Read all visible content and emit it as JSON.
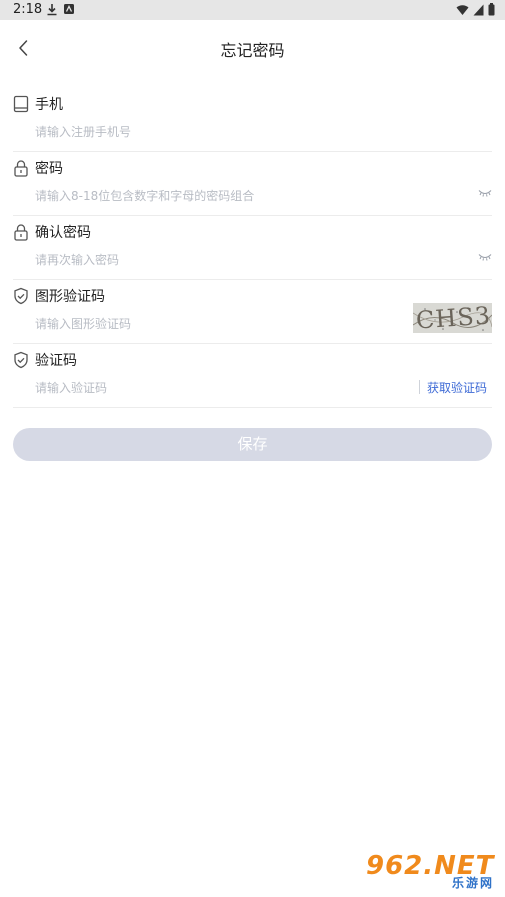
{
  "status_bar": {
    "time": "2:18"
  },
  "header": {
    "title": "忘记密码"
  },
  "fields": [
    {
      "label": "手机",
      "placeholder": "请输入注册手机号",
      "icon": "phone-icon"
    },
    {
      "label": "密码",
      "placeholder": "请输入8-18位包含数字和字母的密码组合",
      "icon": "lock-icon"
    },
    {
      "label": "确认密码",
      "placeholder": "请再次输入密码",
      "icon": "lock-icon"
    },
    {
      "label": "图形验证码",
      "placeholder": "请输入图形验证码",
      "icon": "shield-check-icon",
      "captcha_text": "CHS3"
    },
    {
      "label": "验证码",
      "placeholder": "请输入验证码",
      "icon": "shield-check-icon",
      "action_label": "获取验证码"
    }
  ],
  "save_label": "保存",
  "watermark": {
    "main": "962.NET",
    "sub": "乐游网"
  },
  "colors": {
    "link": "#3f6bd6",
    "save_disabled": "#d6d9e5",
    "divider": "#ececec",
    "placeholder": "#b8bcc4"
  }
}
